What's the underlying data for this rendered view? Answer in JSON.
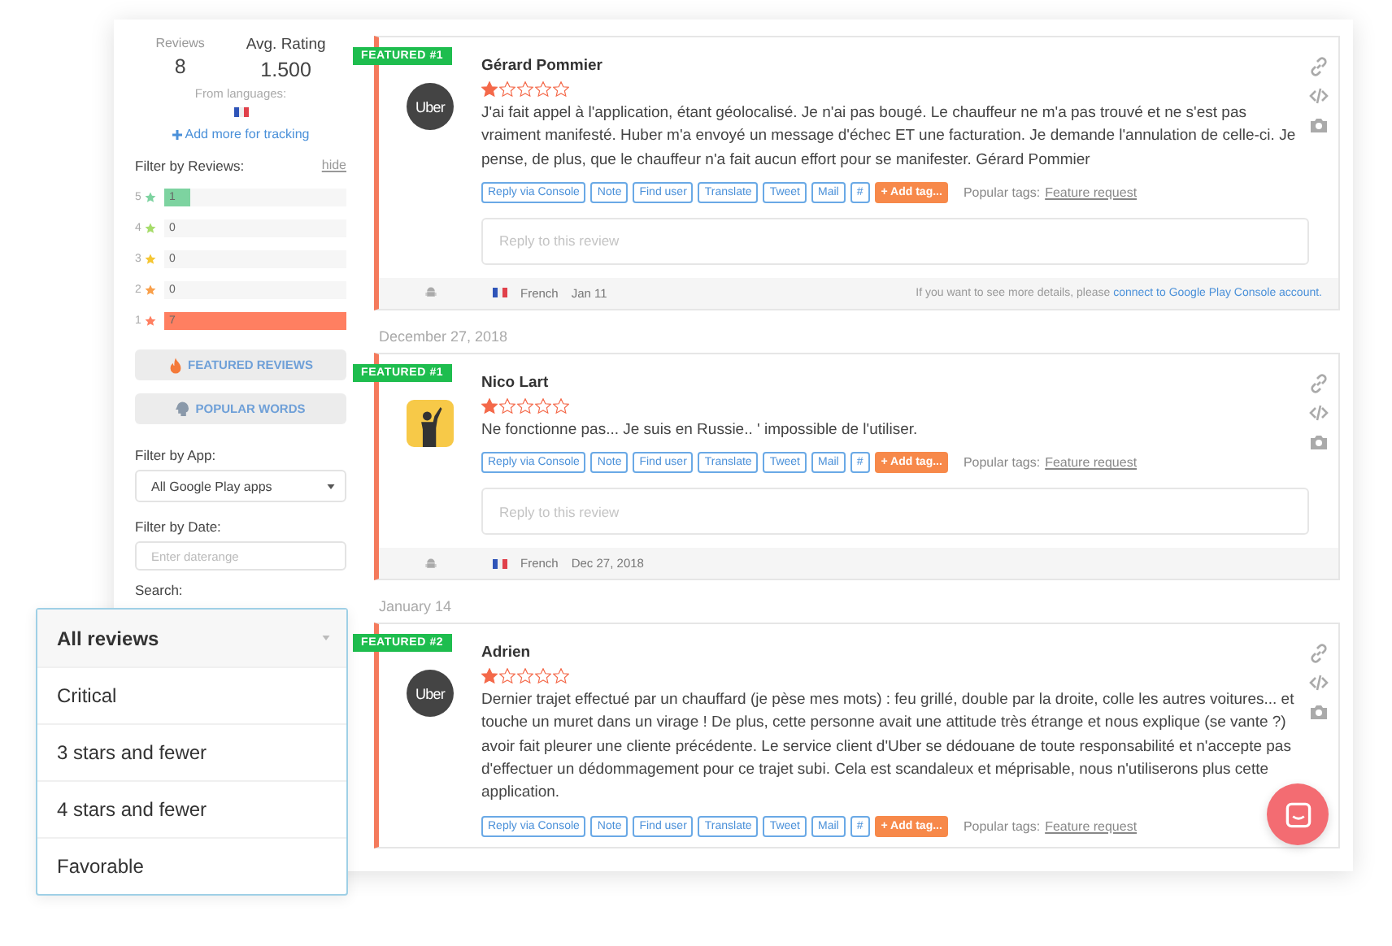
{
  "summary": {
    "reviews_label": "Reviews",
    "reviews_count": "8",
    "rating_label": "Avg. Rating",
    "rating_value": "1.500",
    "languages_label": "From languages:",
    "add_link": "Add more for tracking"
  },
  "filter_reviews": {
    "label": "Filter by Reviews:",
    "hide_link": "hide",
    "bars": [
      {
        "star": "5",
        "count": "1",
        "level": 0.143,
        "color": "#7dd3a0"
      },
      {
        "star": "4",
        "count": "0",
        "level": 0,
        "color": "#a6dc6a"
      },
      {
        "star": "3",
        "count": "0",
        "level": 0,
        "color": "#f5c633"
      },
      {
        "star": "2",
        "count": "0",
        "level": 0,
        "color": "#f9a04b"
      },
      {
        "star": "1",
        "count": "7",
        "level": 1,
        "color": "#ff7f61"
      }
    ]
  },
  "featured_button": "FEATURED REVIEWS",
  "popular_button": "POPULAR WORDS",
  "filter_app": {
    "label": "Filter by App:",
    "value": "All Google Play apps"
  },
  "filter_date": {
    "label": "Filter by Date:",
    "placeholder": "Enter daterange"
  },
  "search_label": "Search:",
  "review_dropdown": {
    "value": "All reviews",
    "options": [
      "Critical",
      "3 stars and fewer",
      "4 stars and fewer",
      "Favorable"
    ]
  },
  "reviews": [
    {
      "badge": "FEATURED #1",
      "author": "Gérard Pommier",
      "stars": 1,
      "avatar": {
        "kind": "logo",
        "text": "Uber"
      },
      "text": "J'ai fait appel à l'application, étant géolocalisé. Je n'ai pas bougé. Le chauffeur ne m'a pas trouvé et ne s'est pas vraiment manifesté. Huber m'a envoyé un message d'échec ET une facturation. Je demande l'annulation de celle-ci. Je pense, de plus, que le chauffeur n'a fait aucun effort pour se manifester. Gérard Pommier",
      "actions": [
        "Reply via Console",
        "Note",
        "Find user",
        "Translate",
        "Tweet",
        "Mail",
        "#"
      ],
      "add_tag": "+ Add tag...",
      "tags_label": "Popular tags:",
      "tag": "Feature request",
      "reply_placeholder": "Reply to this review",
      "language": "French",
      "date": "Jan 11",
      "note": "If you want to see more details, please",
      "note_link": "connect to Google Play Console account."
    },
    {
      "date_header": "December 27, 2018",
      "badge": "FEATURED #1",
      "author": "Nico Lart",
      "stars": 1,
      "text": "Ne fonctionne pas... Je suis en Russie.. ' impossible de l'utiliser.",
      "actions": [
        "Reply via Console",
        "Note",
        "Find user",
        "Translate",
        "Tweet",
        "Mail",
        "#"
      ],
      "add_tag": "+ Add tag...",
      "tags_label": "Popular tags:",
      "tag": "Feature request",
      "reply_placeholder": "Reply to this review",
      "language": "French",
      "date": "Dec 27, 2018"
    },
    {
      "date_header": "January 14",
      "badge": "FEATURED #2",
      "author": "Adrien",
      "stars": 1,
      "avatar": {
        "kind": "logo",
        "text": "Uber"
      },
      "text": "Dernier trajet effectué par un chauffard (je pèse mes mots) : feu grillé, double par la droite, colle les autres voitures... et touche un muret dans un virage ! De plus, cette personne avait une attitude très étrange et nous explique (se vante ?) avoir fait pleurer une cliente précédente. Le service client d'Uber se dédouane de toute responsabilité et n'accepte pas d'effectuer un dédommagement pour ce trajet subi. Cela est scandaleux et méprisable, nous n'utiliserons plus cette application.",
      "actions": [
        "Reply via Console",
        "Note",
        "Find user",
        "Translate",
        "Tweet",
        "Mail",
        "#"
      ],
      "add_tag": "+ Add tag...",
      "tags_label": "Popular tags:",
      "tag": "Feature request"
    }
  ]
}
